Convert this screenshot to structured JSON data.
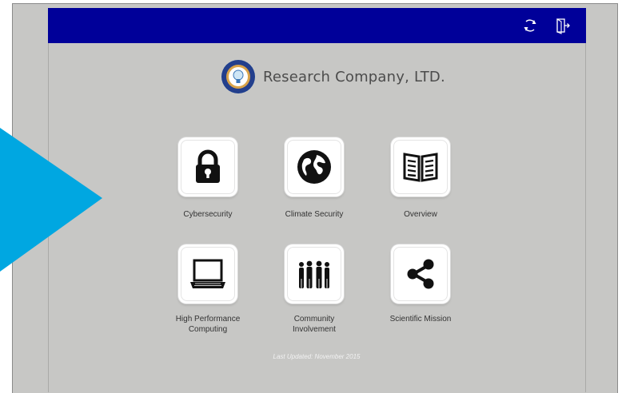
{
  "brand": {
    "name": "Research Company, LTD."
  },
  "topbar": {
    "color": "#000099",
    "icons": [
      "refresh-icon",
      "logout-icon"
    ]
  },
  "tiles": [
    {
      "label": "Cybersecurity",
      "icon": "lock-icon"
    },
    {
      "label": "Climate Security",
      "icon": "globe-icon"
    },
    {
      "label": "Overview",
      "icon": "book-icon"
    },
    {
      "label": "High Performance\nComputing",
      "icon": "laptop-icon"
    },
    {
      "label": "Community\nInvolvement",
      "icon": "people-icon"
    },
    {
      "label": "Scientific Mission",
      "icon": "share-icon"
    }
  ],
  "footer": {
    "text": "Last Updated: November 2015"
  },
  "accent": {
    "arrow": "#00a7e1"
  }
}
